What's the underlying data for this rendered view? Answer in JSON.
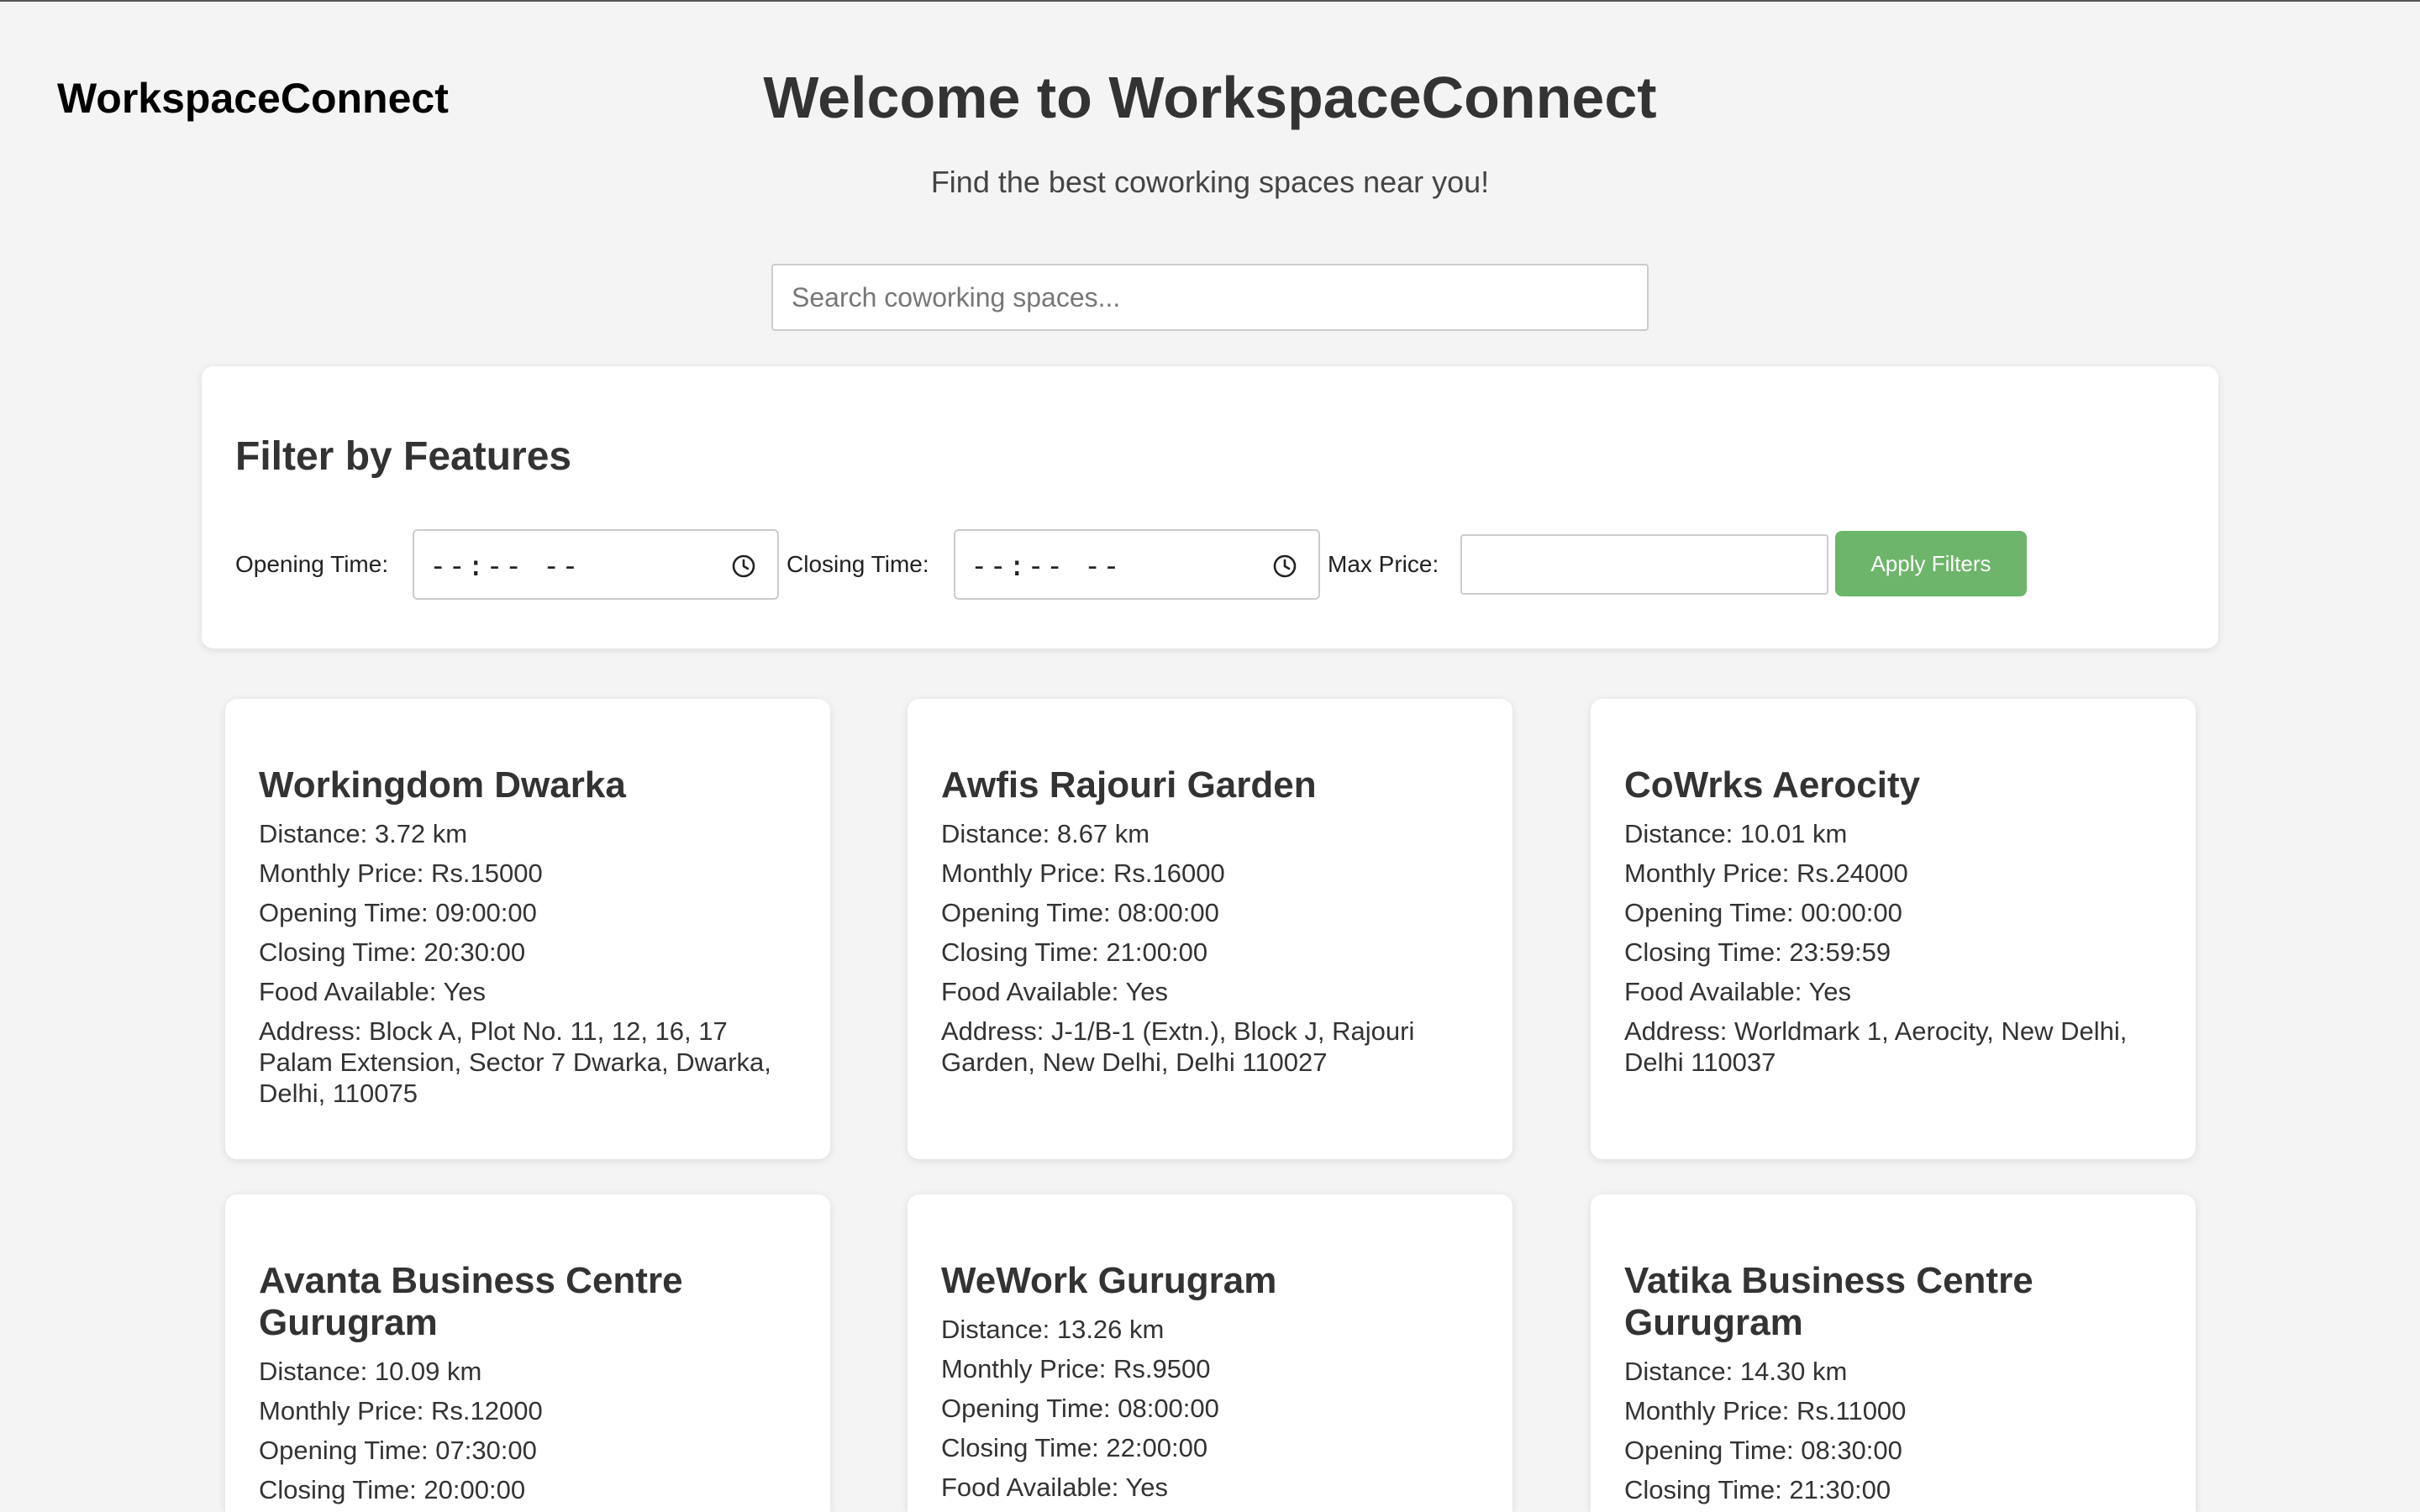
{
  "brand": "WorkspaceConnect",
  "hero": {
    "title": "Welcome to WorkspaceConnect",
    "subtitle": "Find the best coworking spaces near you!"
  },
  "search": {
    "placeholder": "Search coworking spaces...",
    "value": ""
  },
  "filters": {
    "title": "Filter by Features",
    "opening_label": "Opening Time:",
    "opening_value": "--:-- --",
    "closing_label": "Closing Time:",
    "closing_value": "--:-- --",
    "max_price_label": "Max Price:",
    "max_price_value": "",
    "apply_label": "Apply Filters",
    "apply_color": "#6db56a",
    "time_icon": "clock-icon"
  },
  "spaces": [
    {
      "name": "Workingdom Dwarka",
      "distance": "Distance: 3.72 km",
      "price": "Monthly Price: Rs.15000",
      "opening": "Opening Time: 09:00:00",
      "closing": "Closing Time: 20:30:00",
      "food": "Food Available: Yes",
      "address": "Address: Block A, Plot No. 11, 12, 16, 17 Palam Extension, Sector 7 Dwarka, Dwarka, Delhi, 110075"
    },
    {
      "name": "Awfis Rajouri Garden",
      "distance": "Distance: 8.67 km",
      "price": "Monthly Price: Rs.16000",
      "opening": "Opening Time: 08:00:00",
      "closing": "Closing Time: 21:00:00",
      "food": "Food Available: Yes",
      "address": "Address: J-1/B-1 (Extn.), Block J, Rajouri Garden, New Delhi, Delhi 110027"
    },
    {
      "name": "CoWrks Aerocity",
      "distance": "Distance: 10.01 km",
      "price": "Monthly Price: Rs.24000",
      "opening": "Opening Time: 00:00:00",
      "closing": "Closing Time: 23:59:59",
      "food": "Food Available: Yes",
      "address": "Address: Worldmark 1, Aerocity, New Delhi, Delhi 110037"
    },
    {
      "name": "Avanta Business Centre Gurugram",
      "distance": "Distance: 10.09 km",
      "price": "Monthly Price: Rs.12000",
      "opening": "Opening Time: 07:30:00",
      "closing": "Closing Time: 20:00:00"
    },
    {
      "name": "WeWork Gurugram",
      "distance": "Distance: 13.26 km",
      "price": "Monthly Price: Rs.9500",
      "opening": "Opening Time: 08:00:00",
      "closing": "Closing Time: 22:00:00",
      "food": "Food Available: Yes"
    },
    {
      "name": "Vatika Business Centre Gurugram",
      "distance": "Distance: 14.30 km",
      "price": "Monthly Price: Rs.11000",
      "opening": "Opening Time: 08:30:00",
      "closing": "Closing Time: 21:30:00"
    }
  ]
}
